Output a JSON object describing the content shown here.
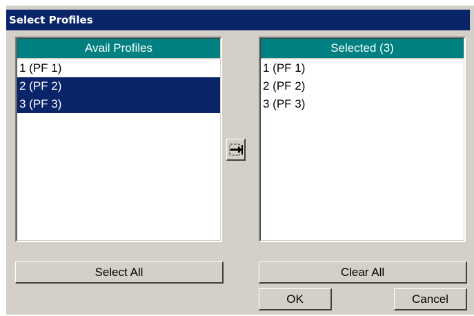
{
  "dialog": {
    "title": "Select Profiles"
  },
  "available": {
    "header": "Avail Profiles",
    "items": [
      {
        "label": "1 (PF 1)",
        "selected": false
      },
      {
        "label": "2 (PF 2)",
        "selected": true
      },
      {
        "label": "3 (PF 3)",
        "selected": true
      }
    ]
  },
  "selected": {
    "header": "Selected  (3)",
    "items": [
      {
        "label": "1 (PF 1)"
      },
      {
        "label": "2 (PF 2)"
      },
      {
        "label": "3 (PF 3)"
      }
    ]
  },
  "buttons": {
    "move_icon": "move-right-arrow-icon",
    "select_all": "Select All",
    "clear_all": "Clear All",
    "ok": "OK",
    "cancel": "Cancel"
  },
  "colors": {
    "titlebar": "#0a246a",
    "header": "#008080",
    "selection": "#0a246a",
    "face": "#d4d0c8"
  }
}
